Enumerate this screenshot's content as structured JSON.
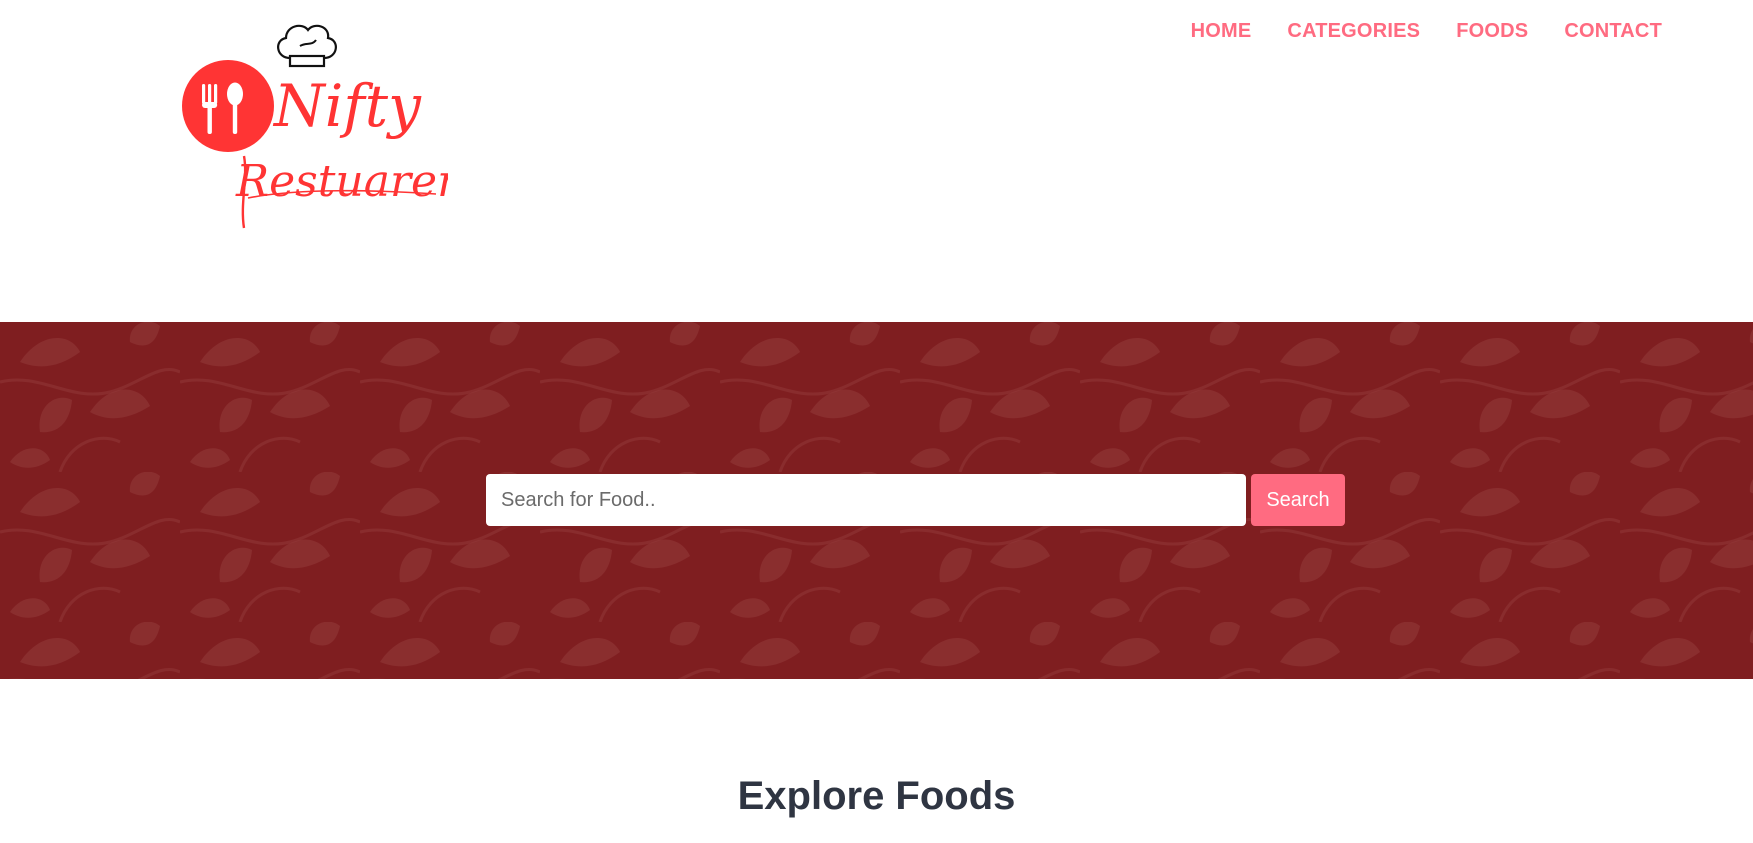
{
  "brand": {
    "logo_line1": "Nifty",
    "logo_line2": "Restuarents",
    "logo_color": "#ff3434"
  },
  "nav": {
    "items": [
      {
        "label": "HOME"
      },
      {
        "label": "CATEGORIES"
      },
      {
        "label": "FOODS"
      },
      {
        "label": "CONTACT"
      }
    ],
    "color": "#ff6b81"
  },
  "hero": {
    "background_color": "#7f1e20",
    "search": {
      "placeholder": "Search for Food..",
      "value": "",
      "button_label": "Search"
    }
  },
  "section": {
    "title": "Explore Foods"
  }
}
